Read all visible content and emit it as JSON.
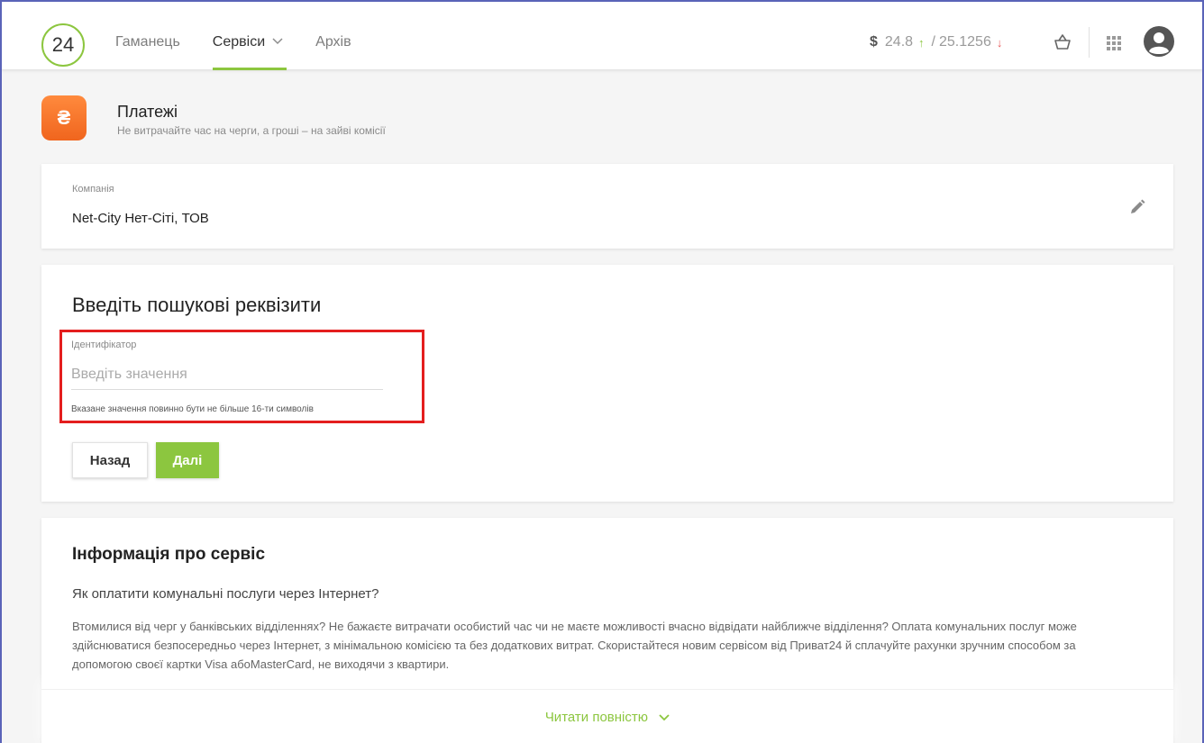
{
  "header": {
    "logo": "24",
    "nav": [
      {
        "label": "Гаманець"
      },
      {
        "label": "Сервіси"
      },
      {
        "label": "Архів"
      }
    ],
    "rate_symbol": "$",
    "rate_buy": "24.8",
    "rate_sep": "/",
    "rate_sell": "25.1256",
    "up_arrow": "↑",
    "down_arrow": "↓"
  },
  "service": {
    "icon_glyph": "₴",
    "title": "Платежі",
    "subtitle": "Не витрачайте час на черги, а гроші – на зайві комісії"
  },
  "company": {
    "label": "Компанія",
    "value": "Net-City Нет-Сіті, ТОВ"
  },
  "search": {
    "heading": "Введіть пошукові реквізити",
    "field_label": "Ідентифікатор",
    "placeholder": "Введіть значення",
    "value": "",
    "hint": "Вказане значення повинно бути не більше 16-ти символів",
    "back_label": "Назад",
    "next_label": "Далі"
  },
  "info": {
    "heading": "Інформація про сервіс",
    "question": "Як оплатити комунальні послуги через Інтернет?",
    "paragraph": "Втомилися від черг у банківських відділеннях? Не бажаєте витрачати особистий час чи не маєте можливості вчасно відвідати найближче відділення? Оплата комунальних послуг може здійснюватися безпосередньо через Інтернет, з мінімальною комісією та без додаткових витрат. Скористайтеся новим сервісом від Приват24 й сплачуйте рахунки зручним способом за допомогою своєї картки Visa абоMasterCard, не виходячи з квартири.",
    "read_more": "Читати повністю"
  },
  "colors": {
    "accent": "#8cc63f",
    "orange": "#f0651e",
    "highlight": "#e41e1e"
  }
}
